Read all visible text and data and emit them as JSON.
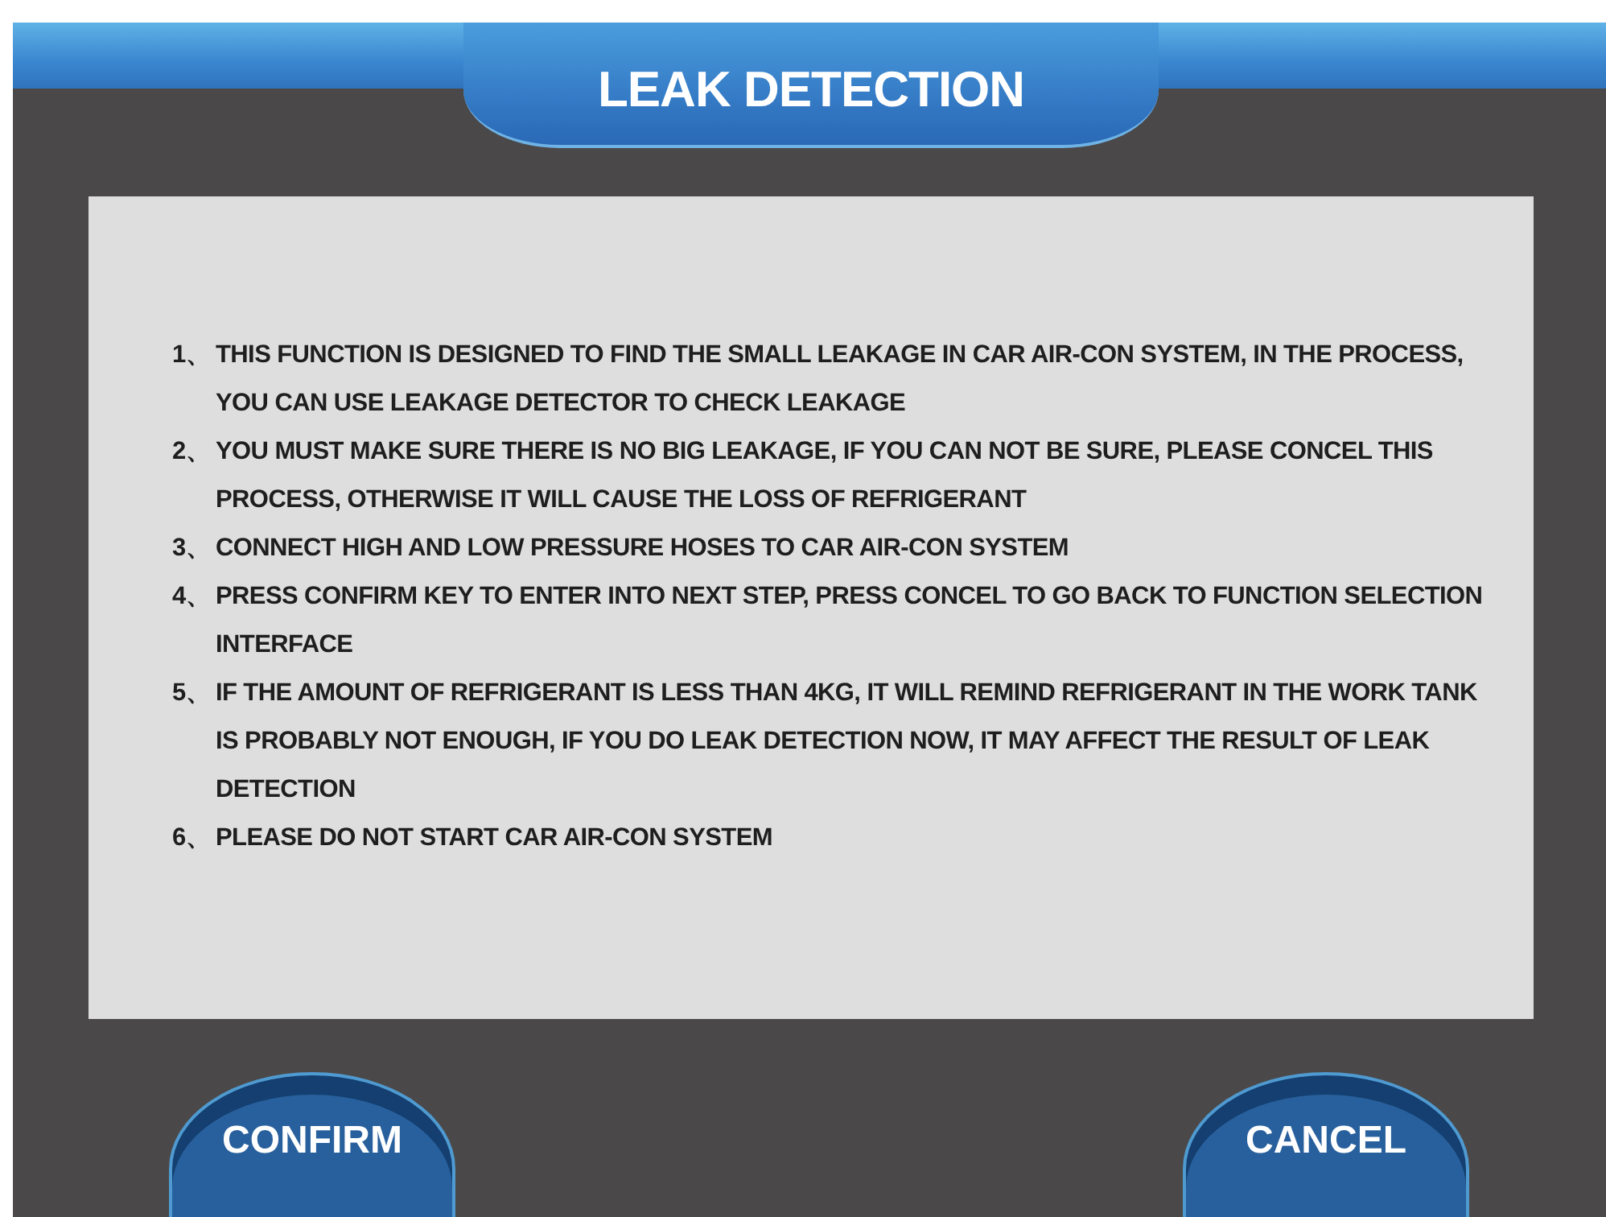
{
  "title": "LEAK DETECTION",
  "instructions": [
    {
      "number": "1、",
      "text": "THIS FUNCTION IS DESIGNED TO FIND THE SMALL LEAKAGE IN CAR AIR-CON SYSTEM, IN THE PROCESS, YOU CAN USE LEAKAGE DETECTOR TO CHECK LEAKAGE"
    },
    {
      "number": "2、",
      "text": "YOU MUST MAKE SURE THERE IS NO BIG LEAKAGE, IF YOU CAN NOT BE SURE, PLEASE CONCEL THIS PROCESS, OTHERWISE IT WILL CAUSE THE LOSS OF REFRIGERANT"
    },
    {
      "number": "3、",
      "text": "CONNECT HIGH AND LOW PRESSURE HOSES TO CAR AIR-CON SYSTEM"
    },
    {
      "number": "4、",
      "text": "PRESS CONFIRM KEY TO ENTER INTO NEXT STEP, PRESS CONCEL TO GO BACK TO FUNCTION SELECTION INTERFACE"
    },
    {
      "number": "5、",
      "text": "IF THE AMOUNT OF REFRIGERANT IS LESS THAN 4KG, IT WILL REMIND REFRIGERANT IN THE WORK TANK IS PROBABLY NOT ENOUGH, IF YOU DO LEAK DETECTION NOW, IT MAY AFFECT THE RESULT OF LEAK DETECTION"
    },
    {
      "number": "6、",
      "text": "PLEASE DO NOT START CAR AIR-CON SYSTEM"
    }
  ],
  "buttons": [
    "CONFIRM",
    "CANCEL"
  ]
}
